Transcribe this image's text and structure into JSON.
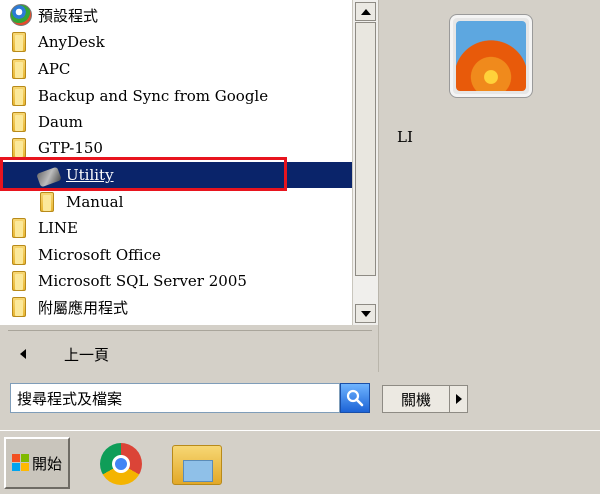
{
  "programs": {
    "items": [
      {
        "label": "預設程式",
        "icon": "default-programs-icon",
        "level": 0
      },
      {
        "label": "AnyDesk",
        "icon": "folder-icon",
        "level": 0
      },
      {
        "label": "APC",
        "icon": "folder-icon",
        "level": 0
      },
      {
        "label": "Backup and Sync from Google",
        "icon": "folder-icon",
        "level": 0
      },
      {
        "label": "Daum",
        "icon": "folder-icon",
        "level": 0
      },
      {
        "label": "GTP-150",
        "icon": "folder-icon",
        "level": 0
      },
      {
        "label": "Utility",
        "icon": "utility-icon",
        "level": 1,
        "selected": true
      },
      {
        "label": "Manual",
        "icon": "folder-icon",
        "level": 1
      },
      {
        "label": "LINE",
        "icon": "folder-icon",
        "level": 0
      },
      {
        "label": "Microsoft Office",
        "icon": "folder-icon",
        "level": 0
      },
      {
        "label": "Microsoft SQL Server 2005",
        "icon": "folder-icon",
        "level": 0
      },
      {
        "label": "附屬應用程式",
        "icon": "folder-icon",
        "level": 0
      }
    ]
  },
  "back": {
    "label": "上一頁"
  },
  "user": {
    "name": "LI"
  },
  "search": {
    "value": "搜尋程式及檔案"
  },
  "shutdown": {
    "label": "關機"
  },
  "taskbar": {
    "start_label": "開始",
    "apps": [
      "chrome-icon",
      "file-explorer-icon"
    ]
  },
  "colors": {
    "selection": "#0a246a",
    "highlight_box": "#e8141e"
  }
}
